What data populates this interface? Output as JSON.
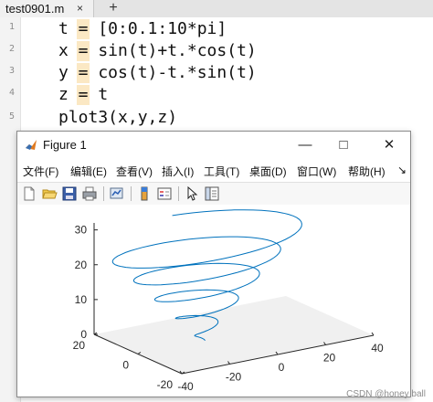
{
  "editor": {
    "tab_name": "test0901.m",
    "tab_close": "×",
    "new_tab": "+",
    "line_numbers": [
      "1",
      "2",
      "3",
      "4",
      "5"
    ],
    "lines": [
      "t = [0:0.1:10*pi]",
      "x = sin(t)+t.*cos(t)",
      "y = cos(t)-t.*sin(t)",
      "z = t",
      "plot3(x,y,z)"
    ]
  },
  "figure": {
    "title": "Figure 1",
    "window_buttons": {
      "minimize": "—",
      "maximize": "□",
      "close": "✕"
    },
    "menu": [
      "文件(F)",
      "编辑(E)",
      "查看(V)",
      "插入(I)",
      "工具(T)",
      "桌面(D)",
      "窗口(W)",
      "帮助(H)"
    ],
    "menu_more": "↘",
    "toolbar_icons": [
      "new-figure-icon",
      "open-file-icon",
      "save-icon",
      "print-icon",
      "link-plot-icon",
      "colorbar-icon",
      "legend-icon",
      "pointer-icon",
      "property-inspector-icon"
    ]
  },
  "chart_data": {
    "type": "line",
    "subtype": "3d-spiral",
    "t_range": [
      0,
      31.4
    ],
    "t_step": 0.1,
    "x_formula": "sin(t)+t.*cos(t)",
    "y_formula": "cos(t)-t.*sin(t)",
    "z_formula": "t",
    "x_ticks": [
      "-40",
      "-20",
      "0",
      "20",
      "40"
    ],
    "y_ticks": [
      "-20",
      "0",
      "20"
    ],
    "z_ticks": [
      "0",
      "10",
      "20",
      "30"
    ],
    "line_color": "#0072bd",
    "title": "",
    "xlabel": "",
    "ylabel": "",
    "zlabel": "",
    "grid": false
  },
  "watermark": "CSDN @honey ball"
}
